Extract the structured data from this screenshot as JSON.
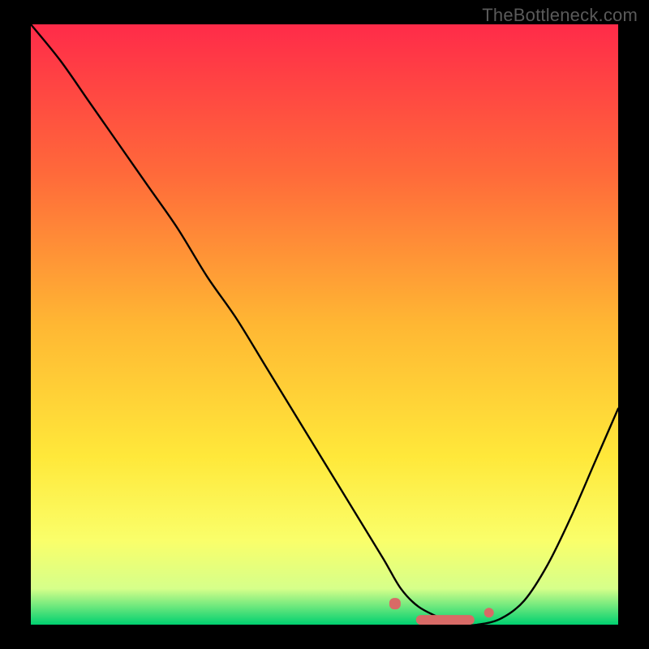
{
  "watermark": "TheBottleneck.com",
  "chart_data": {
    "type": "line",
    "title": "",
    "xlabel": "",
    "ylabel": "",
    "xlim": [
      0,
      100
    ],
    "ylim": [
      0,
      100
    ],
    "background_gradient": {
      "top": "#ff2b49",
      "mid1": "#ff6a3a",
      "mid2": "#ffb733",
      "mid3": "#ffe83a",
      "mid4": "#faff6a",
      "mid5": "#d6ff8a",
      "bottom": "#00d070"
    },
    "series": [
      {
        "name": "bottleneck-curve",
        "color": "#000000",
        "width": 2,
        "x": [
          0,
          5,
          10,
          15,
          20,
          25,
          30,
          35,
          40,
          45,
          50,
          55,
          60,
          63,
          66,
          70,
          73,
          76,
          80,
          84,
          88,
          92,
          96,
          100
        ],
        "y": [
          100,
          94,
          87,
          80,
          73,
          66,
          58,
          51,
          43,
          35,
          27,
          19,
          11,
          6,
          3,
          1,
          0,
          0,
          1,
          4,
          10,
          18,
          27,
          36
        ]
      }
    ],
    "markers": [
      {
        "name": "marker-left",
        "x": 62,
        "y": 3.5,
        "color": "#d86a66",
        "shape": "rounded-square"
      },
      {
        "name": "marker-center",
        "x": 70,
        "y": 0.8,
        "color": "#d86a66",
        "shape": "rounded-bar"
      },
      {
        "name": "marker-right",
        "x": 78,
        "y": 2.0,
        "color": "#d86a66",
        "shape": "dot"
      }
    ]
  }
}
